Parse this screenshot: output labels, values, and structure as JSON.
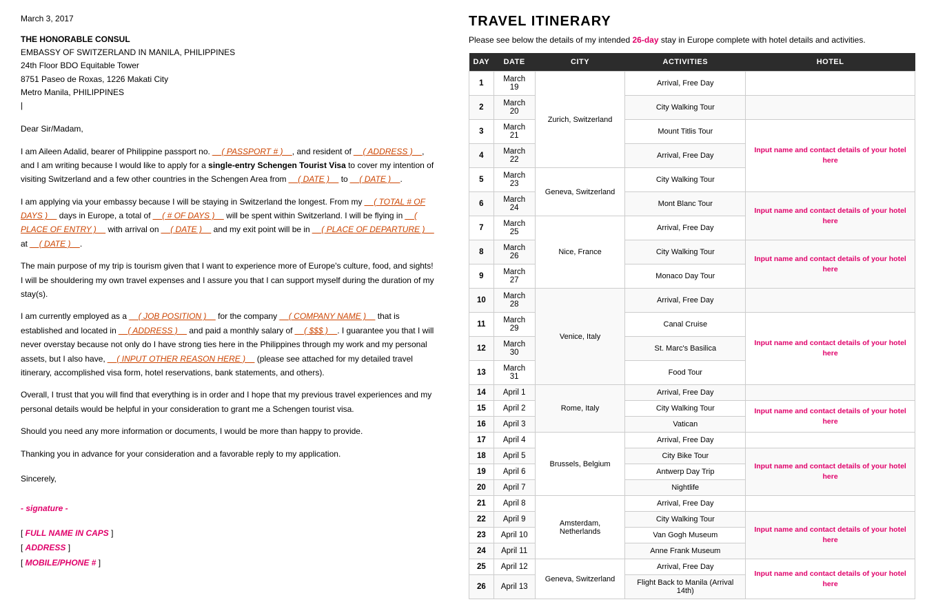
{
  "letter": {
    "date": "March 3, 2017",
    "addressee": {
      "title": "THE HONORABLE CONSUL",
      "line1": "EMBASSY OF SWITZERLAND IN MANILA, PHILIPPINES",
      "line2": "24th Floor BDO Equitable Tower",
      "line3": "8751 Paseo de Roxas, 1226 Makati City",
      "line4": "Metro Manila, PHILIPPINES"
    },
    "salutation": "Dear Sir/Madam,",
    "paragraphs": [
      "I am Aileen Adalid, bearer of Philippine passport no. __(PASSPORT #)__, and resident of __(ADDRESS)__, and I am writing because I would like to apply for a single-entry Schengen Tourist Visa to cover my intention of visiting Switzerland and a few other countries in the Schengen Area from __(DATE)__ to __(DATE)__.",
      "I am applying via your embassy because I will be staying in Switzerland the longest. From my __(TOTAL # OF DAYS)__ days in Europe, a total of __(# OF DAYS)__ will be spent within Switzerland. I will be flying in __(PLACE OF ENTRY)__ with arrival on __(DATE)__ and my exit point will be in __(PLACE OF DEPARTURE)__ at __(DATE)__.",
      "The main purpose of my trip is tourism given that I want to experience more of Europe's culture, food, and sights! I will be shouldering my own travel expenses and I assure you that I can support myself during the duration of my stay(s).",
      "I am currently employed as a __(JOB POSITION)__ for the company __(COMPANY NAME)__ that is established and located in __(ADDRESS)__ and paid a monthly salary of __($$$ )__. I guarantee you that I will never overstay because not only do I have strong ties here in the Philippines through my work and my personal assets, but I also have, __(INPUT OTHER REASON HERE)__ (please see attached for my detailed travel itinerary, accomplished visa form, hotel reservations, bank statements, and others).",
      "Overall, I trust that you will find that everything is in order and I hope that my previous travel experiences and my personal details would be helpful in your consideration to grant me a Schengen tourist visa.",
      "Should you need any more information or documents, I would be more than happy to provide.",
      "Thanking you in advance for your consideration and a favorable reply to my application."
    ],
    "closing": "Sincerely,",
    "signature": "- signature -",
    "footer": [
      "[ FULL NAME IN CAPS ]",
      "[ ADDRESS ]",
      "[ MOBILE/PHONE # ]"
    ]
  },
  "itinerary": {
    "title": "TRAVEL ITINERARY",
    "subtitle_pre": "Please see below the details of my intended ",
    "days_highlight": "26-day",
    "subtitle_post": " stay in Europe complete with hotel details and activities.",
    "columns": [
      "DAY",
      "DATE",
      "CITY",
      "ACTIVITIES",
      "HOTEL"
    ],
    "hotel_placeholder": "Input name and contact details of your hotel here",
    "rows": [
      {
        "day": "1",
        "date": "March 19",
        "city": "",
        "activities": "Arrival, Free Day",
        "hotel_group": "group1",
        "show_hotel": false
      },
      {
        "day": "2",
        "date": "March 20",
        "city": "Zurich, Switzerland",
        "activities": "City Walking Tour",
        "hotel_group": "group1",
        "show_hotel": false
      },
      {
        "day": "3",
        "date": "March 21",
        "city": "",
        "activities": "Mount Titlis Tour",
        "hotel_group": "group1",
        "show_hotel": true,
        "hotel_rowspan": 3
      },
      {
        "day": "4",
        "date": "March 22",
        "city": "",
        "activities": "Arrival, Free Day",
        "hotel_group": "group1",
        "show_hotel": false
      },
      {
        "day": "5",
        "date": "March 23",
        "city": "Geneva, Switzerland",
        "activities": "City Walking Tour",
        "hotel_group": "group2",
        "show_hotel": false
      },
      {
        "day": "6",
        "date": "March 24",
        "city": "",
        "activities": "Mont Blanc Tour",
        "hotel_group": "group2",
        "show_hotel": true,
        "hotel_rowspan": 2
      },
      {
        "day": "7",
        "date": "March 25",
        "city": "",
        "activities": "Arrival, Free Day",
        "hotel_group": "group3",
        "show_hotel": false
      },
      {
        "day": "8",
        "date": "March 26",
        "city": "Nice, France",
        "activities": "City Walking Tour",
        "hotel_group": "group3",
        "show_hotel": true,
        "hotel_rowspan": 2
      },
      {
        "day": "9",
        "date": "March 27",
        "city": "",
        "activities": "Monaco Day Tour",
        "hotel_group": "group3",
        "show_hotel": false
      },
      {
        "day": "10",
        "date": "March 28",
        "city": "",
        "activities": "Arrival, Free Day",
        "hotel_group": "group4",
        "show_hotel": false
      },
      {
        "day": "11",
        "date": "March 29",
        "city": "Venice, Italy",
        "activities": "Canal Cruise",
        "hotel_group": "group4",
        "show_hotel": true,
        "hotel_rowspan": 3
      },
      {
        "day": "12",
        "date": "March 30",
        "city": "",
        "activities": "St. Marc's Basilica",
        "hotel_group": "group4",
        "show_hotel": false
      },
      {
        "day": "13",
        "date": "March 31",
        "city": "",
        "activities": "Food Tour",
        "hotel_group": "group4",
        "show_hotel": false
      },
      {
        "day": "14",
        "date": "April 1",
        "city": "",
        "activities": "Arrival, Free Day",
        "hotel_group": "group5",
        "show_hotel": false
      },
      {
        "day": "15",
        "date": "April 2",
        "city": "Rome, Italy",
        "activities": "City Walking Tour",
        "hotel_group": "group5",
        "show_hotel": true,
        "hotel_rowspan": 2
      },
      {
        "day": "16",
        "date": "April 3",
        "city": "",
        "activities": "Vatican",
        "hotel_group": "group5",
        "show_hotel": false
      },
      {
        "day": "17",
        "date": "April 4",
        "city": "",
        "activities": "Arrival, Free Day",
        "hotel_group": "group6",
        "show_hotel": false
      },
      {
        "day": "18",
        "date": "April 5",
        "city": "Brussels, Belgium",
        "activities": "City Bike Tour",
        "hotel_group": "group6",
        "show_hotel": true,
        "hotel_rowspan": 3
      },
      {
        "day": "19",
        "date": "April 6",
        "city": "",
        "activities": "Antwerp Day Trip",
        "hotel_group": "group6",
        "show_hotel": false
      },
      {
        "day": "20",
        "date": "April 7",
        "city": "",
        "activities": "Nightlife",
        "hotel_group": "group6",
        "show_hotel": false
      },
      {
        "day": "21",
        "date": "April 8",
        "city": "",
        "activities": "Arrival, Free Day",
        "hotel_group": "group7",
        "show_hotel": false
      },
      {
        "day": "22",
        "date": "April 9",
        "city": "Amsterdam, Netherlands",
        "activities": "City Walking Tour",
        "hotel_group": "group7",
        "show_hotel": true,
        "hotel_rowspan": 3
      },
      {
        "day": "23",
        "date": "April 10",
        "city": "",
        "activities": "Van Gogh Museum",
        "hotel_group": "group7",
        "show_hotel": false
      },
      {
        "day": "24",
        "date": "April 11",
        "city": "",
        "activities": "Anne Frank Museum",
        "hotel_group": "group7",
        "show_hotel": false
      },
      {
        "day": "25",
        "date": "April 12",
        "city": "Geneva, Switzerland",
        "activities": "Arrival, Free Day",
        "hotel_group": "group8",
        "show_hotel": true,
        "hotel_rowspan": 2
      },
      {
        "day": "26",
        "date": "April 13",
        "city": "",
        "activities": "Flight Back to Manila (Arrival 14th)",
        "hotel_group": "group8",
        "show_hotel": false
      }
    ]
  }
}
